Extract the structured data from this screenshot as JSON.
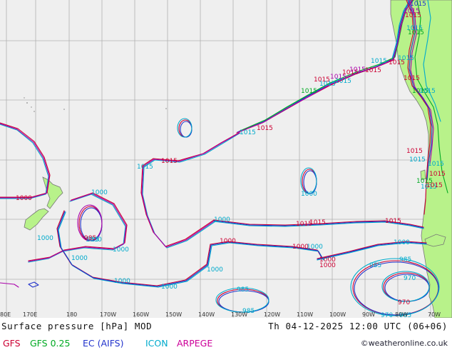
{
  "map": {
    "lon_ticks": [
      "180",
      "170W",
      "160W",
      "150W",
      "140W",
      "130W",
      "120W",
      "110W",
      "100W",
      "90W",
      "80W",
      "70W"
    ],
    "edge_ticks": [
      "80E",
      "170E"
    ],
    "colors": {
      "ocean": "#efefef",
      "land": "#b8f28a",
      "grid": "#b0b0b0",
      "coast": "#888888",
      "gfs": "#cc0033",
      "gfs025": "#00aa22",
      "ec": "#2233cc",
      "icon": "#00aacc",
      "arpege": "#aa00aa"
    },
    "isobar_labels": [
      {
        "text": "1015",
        "model": "arpege"
      },
      {
        "text": "1015",
        "model": "gfs"
      },
      {
        "text": "1015",
        "model": "icon"
      },
      {
        "text": "1015",
        "model": "gfs025"
      },
      {
        "text": "1015",
        "model": "ec"
      },
      {
        "text": "1015",
        "model": "gfs"
      },
      {
        "text": "1015",
        "model": "icon"
      },
      {
        "text": "1015",
        "model": "arpege"
      },
      {
        "text": "1015",
        "model": "icon"
      },
      {
        "text": "1015",
        "model": "gfs"
      },
      {
        "text": "1015",
        "model": "gfs025"
      },
      {
        "text": "1015",
        "model": "gfs"
      },
      {
        "text": "1015",
        "model": "icon"
      },
      {
        "text": "1015",
        "model": "gfs"
      },
      {
        "text": "1015",
        "model": "icon"
      },
      {
        "text": "1015",
        "model": "gfs"
      },
      {
        "text": "1015",
        "model": "gfs025"
      },
      {
        "text": "1015",
        "model": "icon"
      },
      {
        "text": "1015",
        "model": "gfs"
      },
      {
        "text": "1015",
        "model": "icon"
      },
      {
        "text": "1015",
        "model": "arpege"
      },
      {
        "text": "1015",
        "model": "gfs"
      },
      {
        "text": "1015",
        "model": "icon"
      },
      {
        "text": "1015",
        "model": "icon"
      },
      {
        "text": "1015",
        "model": "gfs"
      },
      {
        "text": "1015",
        "model": "gfs025"
      },
      {
        "text": "1015",
        "model": "icon"
      },
      {
        "text": "1015",
        "model": "gfs"
      },
      {
        "text": "1015",
        "model": "gfs"
      },
      {
        "text": "1015",
        "model": "icon"
      },
      {
        "text": "1015",
        "model": "gfs"
      },
      {
        "text": "1015",
        "model": "gfs"
      },
      {
        "text": "1015",
        "model": "gfs"
      },
      {
        "text": "1000",
        "model": "gfs"
      },
      {
        "text": "1000",
        "model": "icon"
      },
      {
        "text": "1000",
        "model": "icon"
      },
      {
        "text": "1000",
        "model": "icon"
      },
      {
        "text": "1000",
        "model": "icon"
      },
      {
        "text": "1000",
        "model": "icon"
      },
      {
        "text": "1000",
        "model": "icon"
      },
      {
        "text": "1000",
        "model": "icon"
      },
      {
        "text": "1000",
        "model": "icon"
      },
      {
        "text": "1000",
        "model": "gfs"
      },
      {
        "text": "1000",
        "model": "icon"
      },
      {
        "text": "1000",
        "model": "gfs"
      },
      {
        "text": "1000",
        "model": "icon"
      },
      {
        "text": "1000",
        "model": "icon"
      },
      {
        "text": "1000",
        "model": "gfs"
      },
      {
        "text": "1000",
        "model": "gfs"
      },
      {
        "text": "1000",
        "model": "icon"
      },
      {
        "text": "985",
        "model": "icon"
      },
      {
        "text": "985",
        "model": "gfs"
      },
      {
        "text": "985",
        "model": "icon"
      },
      {
        "text": "985",
        "model": "icon"
      },
      {
        "text": "985",
        "model": "icon"
      },
      {
        "text": "985",
        "model": "icon"
      },
      {
        "text": "985",
        "model": "icon"
      },
      {
        "text": "970",
        "model": "icon"
      },
      {
        "text": "970",
        "model": "gfs"
      },
      {
        "text": "970",
        "model": "icon"
      }
    ]
  },
  "header": {
    "left": "Surface pressure [hPa] MOD",
    "right": "Th 04-12-2025 12:00 UTC (06+06)"
  },
  "legend": {
    "models": [
      {
        "label": "GFS",
        "color": "#cc0033"
      },
      {
        "label": "GFS 0.25",
        "color": "#00aa22"
      },
      {
        "label": "EC (AIFS)",
        "color": "#2233cc"
      },
      {
        "label": "ICON",
        "color": "#00aacc"
      },
      {
        "label": "ARPEGE",
        "color": "#cc0099"
      }
    ],
    "credit": "©weatheronline.co.uk"
  }
}
